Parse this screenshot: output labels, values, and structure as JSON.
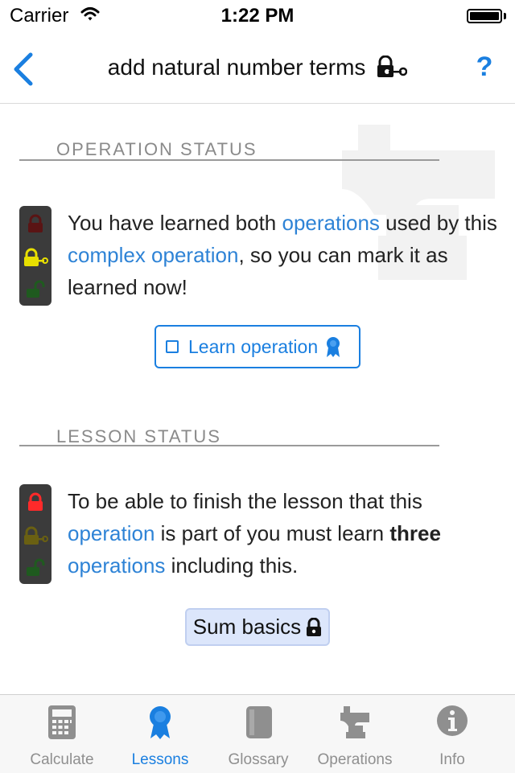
{
  "status_bar": {
    "carrier": "Carrier",
    "time": "1:22 PM"
  },
  "nav": {
    "title": "add natural number terms",
    "help_label": "?",
    "back_icon": "chevron-left-icon",
    "title_icon": "lock-with-key-icon"
  },
  "operation_status": {
    "heading": "OPERATION STATUS",
    "message_parts": [
      "You have learned both ",
      "operations",
      " used by this ",
      "complex operation",
      ", so you can mark it as learned now!"
    ],
    "traffic_light_active": "yellow",
    "learn_button_label": "Learn operation"
  },
  "lesson_status": {
    "heading": "LESSON STATUS",
    "message_parts": [
      "To be able to finish the lesson that this ",
      "operation",
      " is part of you must learn ",
      "three",
      " ",
      "operations",
      " including this."
    ],
    "traffic_light_active": "red",
    "lesson_chip_label": "Sum basics"
  },
  "tabs": [
    {
      "label": "Calculate",
      "icon": "calculator-icon",
      "active": false
    },
    {
      "label": "Lessons",
      "icon": "ribbon-badge-icon",
      "active": true
    },
    {
      "label": "Glossary",
      "icon": "book-icon",
      "active": false
    },
    {
      "label": "Operations",
      "icon": "anvil-icon",
      "active": false
    },
    {
      "label": "Info",
      "icon": "info-icon",
      "active": false
    }
  ],
  "colors": {
    "accent": "#1a7fe0",
    "link": "#2e83d6",
    "section_heading": "#8a8a8a",
    "chip_background": "#dce6fb"
  }
}
